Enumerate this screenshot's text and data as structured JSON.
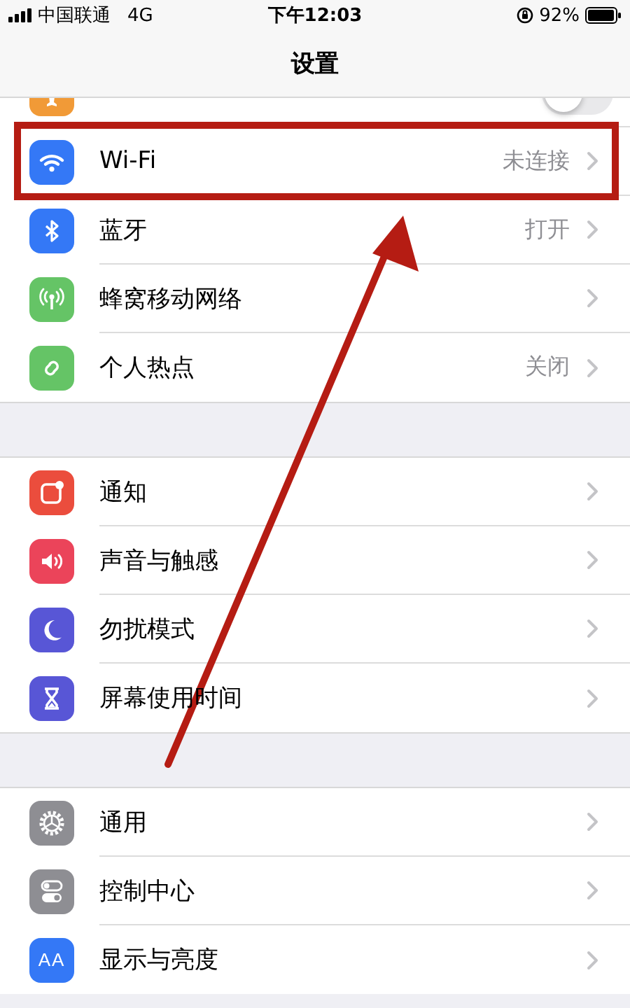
{
  "status_bar": {
    "carrier": "中国联通",
    "network": "4G",
    "time": "下午12:03",
    "battery": "92%"
  },
  "nav": {
    "title": "设置"
  },
  "groups": [
    {
      "items": [
        {
          "color": "#f19a37",
          "kind": "toggle",
          "on": false
        },
        {
          "color": "#3478f6",
          "label": "Wi-Fi",
          "value": "未连接",
          "kind": "link"
        },
        {
          "color": "#3478f6",
          "label": "蓝牙",
          "value": "打开",
          "kind": "link"
        },
        {
          "color": "#65c466",
          "label": "蜂窝移动网络",
          "kind": "link"
        },
        {
          "color": "#65c466",
          "label": "个人热点",
          "value": "关闭",
          "kind": "link"
        }
      ]
    },
    {
      "items": [
        {
          "color": "#eb4d3d",
          "label": "通知",
          "kind": "link"
        },
        {
          "color": "#eb445a",
          "label": "声音与触感",
          "kind": "link"
        },
        {
          "color": "#5856d6",
          "label": "勿扰模式",
          "kind": "link"
        },
        {
          "color": "#5856d6",
          "label": "屏幕使用时间",
          "kind": "link"
        }
      ]
    },
    {
      "items": [
        {
          "color": "#8e8e93",
          "label": "通用",
          "kind": "link"
        },
        {
          "color": "#8e8e93",
          "label": "控制中心",
          "kind": "link"
        },
        {
          "icon_text": "AA",
          "color": "#3478f6",
          "label": "显示与亮度",
          "kind": "link"
        }
      ]
    }
  ],
  "annotation": {
    "box": true,
    "arrow": true
  }
}
